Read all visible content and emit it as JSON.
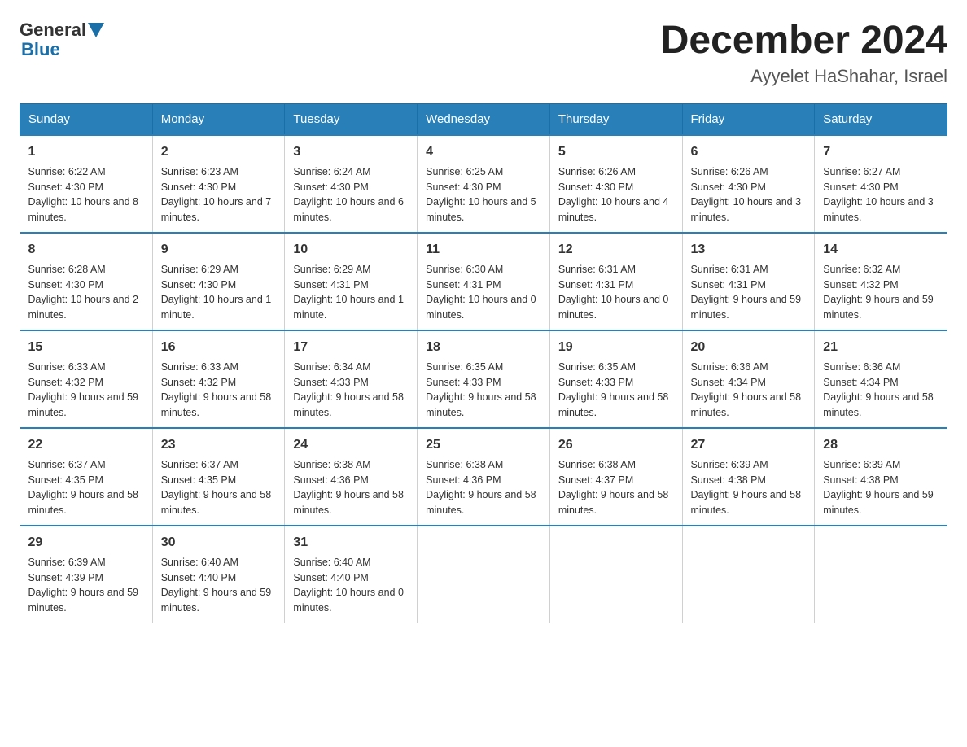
{
  "header": {
    "logo_general": "General",
    "logo_blue": "Blue",
    "month_title": "December 2024",
    "location": "Ayyelet HaShahar, Israel"
  },
  "days_of_week": [
    "Sunday",
    "Monday",
    "Tuesday",
    "Wednesday",
    "Thursday",
    "Friday",
    "Saturday"
  ],
  "weeks": [
    [
      {
        "day": "1",
        "sunrise": "6:22 AM",
        "sunset": "4:30 PM",
        "daylight": "10 hours and 8 minutes."
      },
      {
        "day": "2",
        "sunrise": "6:23 AM",
        "sunset": "4:30 PM",
        "daylight": "10 hours and 7 minutes."
      },
      {
        "day": "3",
        "sunrise": "6:24 AM",
        "sunset": "4:30 PM",
        "daylight": "10 hours and 6 minutes."
      },
      {
        "day": "4",
        "sunrise": "6:25 AM",
        "sunset": "4:30 PM",
        "daylight": "10 hours and 5 minutes."
      },
      {
        "day": "5",
        "sunrise": "6:26 AM",
        "sunset": "4:30 PM",
        "daylight": "10 hours and 4 minutes."
      },
      {
        "day": "6",
        "sunrise": "6:26 AM",
        "sunset": "4:30 PM",
        "daylight": "10 hours and 3 minutes."
      },
      {
        "day": "7",
        "sunrise": "6:27 AM",
        "sunset": "4:30 PM",
        "daylight": "10 hours and 3 minutes."
      }
    ],
    [
      {
        "day": "8",
        "sunrise": "6:28 AM",
        "sunset": "4:30 PM",
        "daylight": "10 hours and 2 minutes."
      },
      {
        "day": "9",
        "sunrise": "6:29 AM",
        "sunset": "4:30 PM",
        "daylight": "10 hours and 1 minute."
      },
      {
        "day": "10",
        "sunrise": "6:29 AM",
        "sunset": "4:31 PM",
        "daylight": "10 hours and 1 minute."
      },
      {
        "day": "11",
        "sunrise": "6:30 AM",
        "sunset": "4:31 PM",
        "daylight": "10 hours and 0 minutes."
      },
      {
        "day": "12",
        "sunrise": "6:31 AM",
        "sunset": "4:31 PM",
        "daylight": "10 hours and 0 minutes."
      },
      {
        "day": "13",
        "sunrise": "6:31 AM",
        "sunset": "4:31 PM",
        "daylight": "9 hours and 59 minutes."
      },
      {
        "day": "14",
        "sunrise": "6:32 AM",
        "sunset": "4:32 PM",
        "daylight": "9 hours and 59 minutes."
      }
    ],
    [
      {
        "day": "15",
        "sunrise": "6:33 AM",
        "sunset": "4:32 PM",
        "daylight": "9 hours and 59 minutes."
      },
      {
        "day": "16",
        "sunrise": "6:33 AM",
        "sunset": "4:32 PM",
        "daylight": "9 hours and 58 minutes."
      },
      {
        "day": "17",
        "sunrise": "6:34 AM",
        "sunset": "4:33 PM",
        "daylight": "9 hours and 58 minutes."
      },
      {
        "day": "18",
        "sunrise": "6:35 AM",
        "sunset": "4:33 PM",
        "daylight": "9 hours and 58 minutes."
      },
      {
        "day": "19",
        "sunrise": "6:35 AM",
        "sunset": "4:33 PM",
        "daylight": "9 hours and 58 minutes."
      },
      {
        "day": "20",
        "sunrise": "6:36 AM",
        "sunset": "4:34 PM",
        "daylight": "9 hours and 58 minutes."
      },
      {
        "day": "21",
        "sunrise": "6:36 AM",
        "sunset": "4:34 PM",
        "daylight": "9 hours and 58 minutes."
      }
    ],
    [
      {
        "day": "22",
        "sunrise": "6:37 AM",
        "sunset": "4:35 PM",
        "daylight": "9 hours and 58 minutes."
      },
      {
        "day": "23",
        "sunrise": "6:37 AM",
        "sunset": "4:35 PM",
        "daylight": "9 hours and 58 minutes."
      },
      {
        "day": "24",
        "sunrise": "6:38 AM",
        "sunset": "4:36 PM",
        "daylight": "9 hours and 58 minutes."
      },
      {
        "day": "25",
        "sunrise": "6:38 AM",
        "sunset": "4:36 PM",
        "daylight": "9 hours and 58 minutes."
      },
      {
        "day": "26",
        "sunrise": "6:38 AM",
        "sunset": "4:37 PM",
        "daylight": "9 hours and 58 minutes."
      },
      {
        "day": "27",
        "sunrise": "6:39 AM",
        "sunset": "4:38 PM",
        "daylight": "9 hours and 58 minutes."
      },
      {
        "day": "28",
        "sunrise": "6:39 AM",
        "sunset": "4:38 PM",
        "daylight": "9 hours and 59 minutes."
      }
    ],
    [
      {
        "day": "29",
        "sunrise": "6:39 AM",
        "sunset": "4:39 PM",
        "daylight": "9 hours and 59 minutes."
      },
      {
        "day": "30",
        "sunrise": "6:40 AM",
        "sunset": "4:40 PM",
        "daylight": "9 hours and 59 minutes."
      },
      {
        "day": "31",
        "sunrise": "6:40 AM",
        "sunset": "4:40 PM",
        "daylight": "10 hours and 0 minutes."
      },
      null,
      null,
      null,
      null
    ]
  ]
}
